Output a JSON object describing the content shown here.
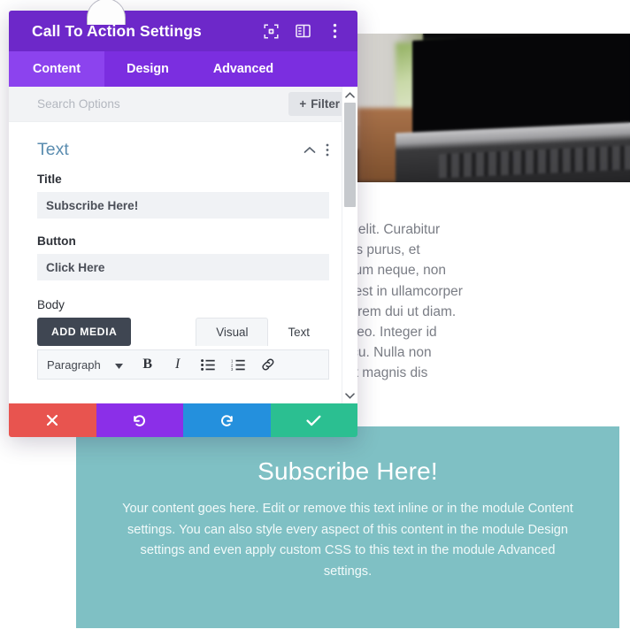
{
  "modal": {
    "title": "Call To Action Settings",
    "header_icons": [
      {
        "name": "focus-icon",
        "label": "Focus"
      },
      {
        "name": "layout-icon",
        "label": "Layout"
      },
      {
        "name": "more-vertical-icon",
        "label": "More"
      }
    ],
    "tabs": [
      {
        "label": "Content",
        "active": true
      },
      {
        "label": "Design",
        "active": false
      },
      {
        "label": "Advanced",
        "active": false
      }
    ],
    "search": {
      "placeholder": "Search Options",
      "value": ""
    },
    "filter_button": {
      "label": "Filter",
      "plus": "+"
    },
    "section": {
      "title": "Text",
      "collapse_icon": "chevron-up-icon",
      "menu_icon": "more-vertical-icon"
    },
    "fields": [
      {
        "label": "Title",
        "value": "Subscribe Here!"
      },
      {
        "label": "Button",
        "value": "Click Here"
      }
    ],
    "body_field": {
      "label": "Body",
      "add_media_label": "ADD MEDIA",
      "editor_tabs": [
        {
          "label": "Visual",
          "active": true
        },
        {
          "label": "Text",
          "active": false
        }
      ],
      "toolbar": {
        "format_select": "Paragraph",
        "buttons": [
          {
            "name": "bold-button",
            "glyph": "B"
          },
          {
            "name": "italic-button",
            "glyph": "I"
          },
          {
            "name": "bulleted-list-button",
            "glyph": ""
          },
          {
            "name": "numbered-list-button",
            "glyph": ""
          },
          {
            "name": "link-button",
            "glyph": ""
          }
        ]
      }
    },
    "scrollbar": {
      "up_arrow": "chevron-up-icon",
      "down_arrow": "chevron-down-icon"
    },
    "actions": [
      {
        "name": "cancel-button",
        "icon": "close-icon",
        "color": "#e8544f"
      },
      {
        "name": "undo-button",
        "icon": "undo-icon",
        "color": "#8b2fe8"
      },
      {
        "name": "redo-button",
        "icon": "redo-icon",
        "color": "#2490dd"
      },
      {
        "name": "save-button",
        "icon": "check-icon",
        "color": "#2bbf91"
      }
    ]
  },
  "page_background": {
    "photo_alt": "laptop-on-desk-photo",
    "text_lines": [
      "g elit. Curabitur",
      "llis purus, et",
      "dum neque, non",
      ", est in ullamcorper",
      " lorem dui ut diam.",
      "l leo. Integer id",
      "rcu. Nulla non",
      "et magnis dis"
    ]
  },
  "cta_module": {
    "title": "Subscribe Here!",
    "body": "Your content goes here. Edit or remove this text inline or in the module Content settings. You can also style every aspect of this content in the module Design settings and even apply custom CSS to this text in the module Advanced settings.",
    "background_color": "#7fc0c4"
  },
  "colors": {
    "header_purple": "#6d28c9",
    "tabbar_purple": "#7b2ee0",
    "tab_active_purple": "#8c43ee",
    "section_title_blue": "#5b8db0",
    "teal": "#7fc0c4"
  }
}
